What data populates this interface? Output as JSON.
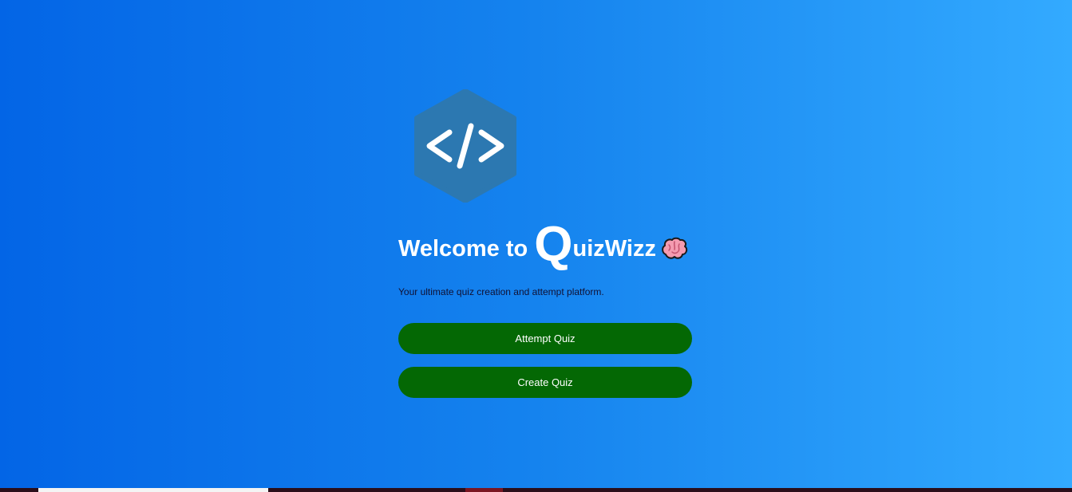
{
  "app": {
    "title_prefix": "Welcome to ",
    "title_big_letter": "Q",
    "title_rest": "uizWizz",
    "subtitle": "Your ultimate quiz creation and attempt platform."
  },
  "logo": {
    "icon": "code-brackets-hexagon-icon",
    "color": "#2c78b1"
  },
  "buttons": {
    "attempt_label": "Attempt Quiz",
    "create_label": "Create Quiz",
    "color": "#046804"
  },
  "colors": {
    "gradient_start": "#0365e6",
    "gradient_end": "#33aaff"
  }
}
